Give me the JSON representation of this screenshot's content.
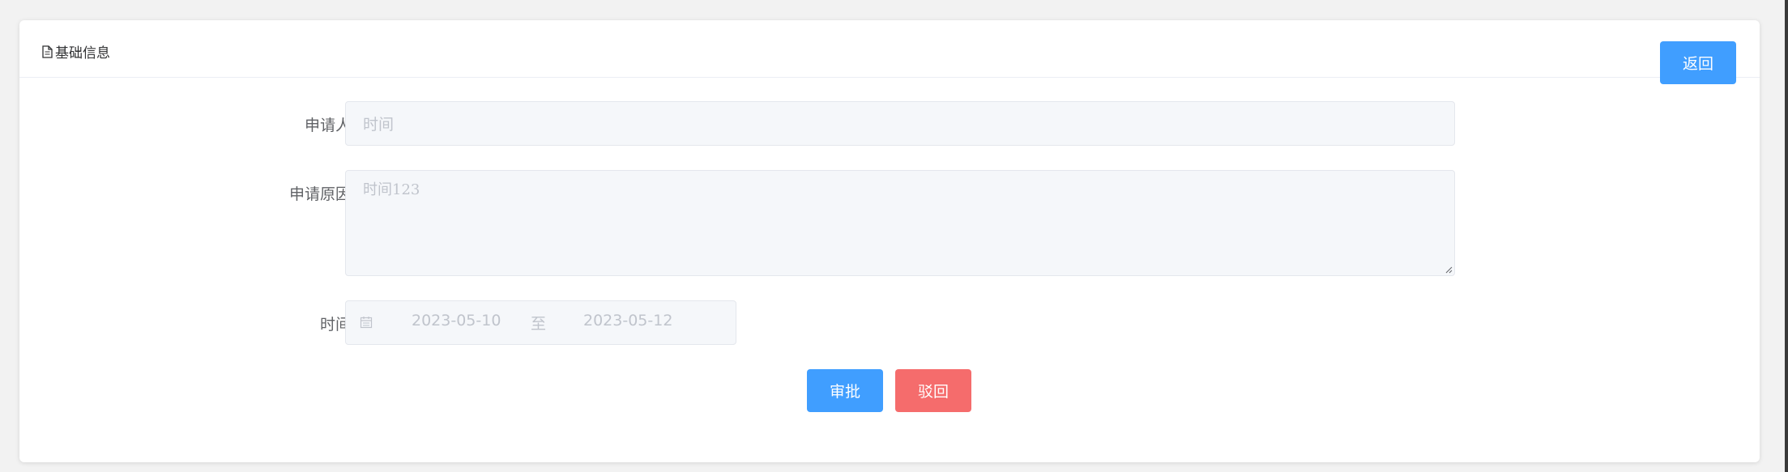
{
  "header": {
    "title": "基础信息",
    "back_label": "返回"
  },
  "form": {
    "applicant": {
      "label": "申请人",
      "value": "时间"
    },
    "reason": {
      "label": "申请原因",
      "value": "时间123"
    },
    "time": {
      "label": "时间",
      "start": "2023-05-10",
      "separator": "至",
      "end": "2023-05-12"
    }
  },
  "actions": {
    "approve_label": "审批",
    "reject_label": "驳回"
  },
  "colors": {
    "primary": "#409eff",
    "danger": "#f56c6c",
    "disabled_bg": "#f5f7fa",
    "placeholder_text": "#c0c4cc"
  }
}
